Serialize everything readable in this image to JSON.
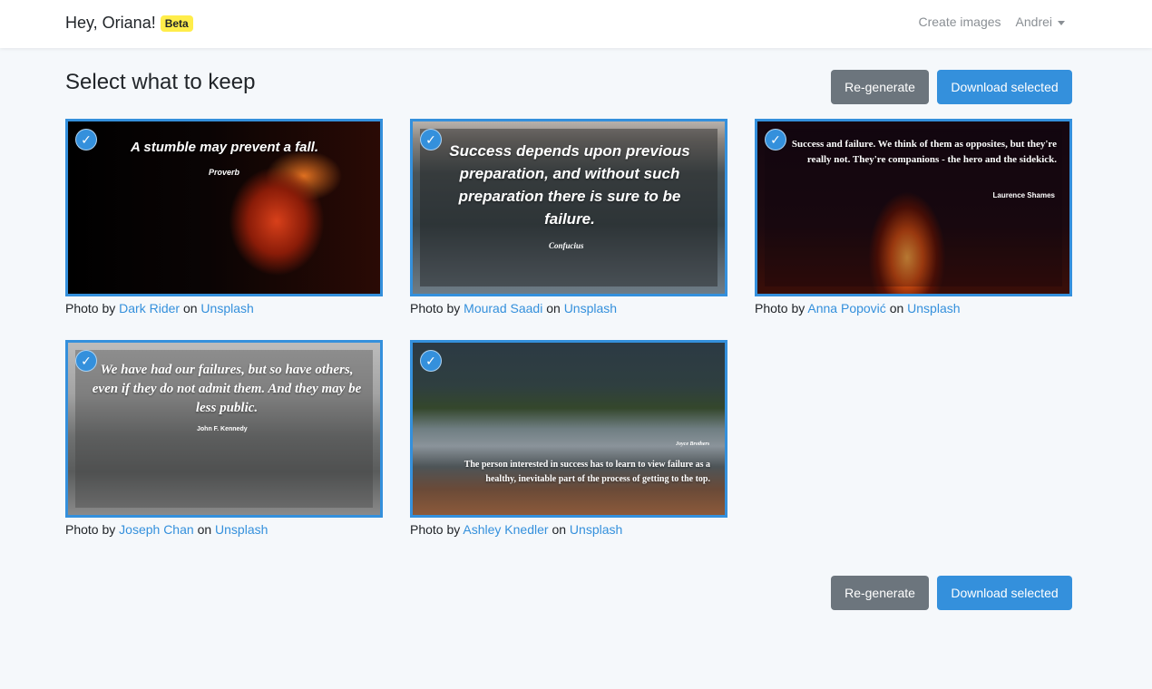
{
  "navbar": {
    "brand": "Hey, Oriana!",
    "badge": "Beta",
    "create_link": "Create images",
    "user_menu": "Andrei"
  },
  "page": {
    "title": "Select what to keep"
  },
  "buttons": {
    "regenerate": "Re-generate",
    "download": "Download selected"
  },
  "check_glyph": "✓",
  "caption": {
    "prefix": "Photo by",
    "on": "on",
    "site": "Unsplash"
  },
  "cards": [
    {
      "quote": "A stumble may prevent a fall.",
      "author": "Proverb",
      "photographer": "Dark Rider",
      "selected": true
    },
    {
      "quote": "Success depends upon previous preparation, and without such preparation there is sure to be failure.",
      "author": "Confucius",
      "photographer": "Mourad Saadi",
      "selected": true
    },
    {
      "quote": "Success and failure. We think of them as opposites, but they're really not. They're companions - the hero and the sidekick.",
      "author": "Laurence Shames",
      "photographer": "Anna Popović",
      "selected": true
    },
    {
      "quote": "We have had our failures, but so have others, even if they do not admit them. And they may be less public.",
      "author": "John F. Kennedy",
      "photographer": "Joseph Chan",
      "selected": true
    },
    {
      "quote": "The person interested in success has to learn to view failure as a healthy, inevitable part of the process of getting to the top.",
      "author": "Joyce Brothers",
      "photographer": "Ashley Knedler",
      "selected": true
    }
  ],
  "colors": {
    "primary": "#3490dc",
    "secondary": "#6c757d",
    "badge": "#ffed4a",
    "background": "#f5f8fb"
  }
}
